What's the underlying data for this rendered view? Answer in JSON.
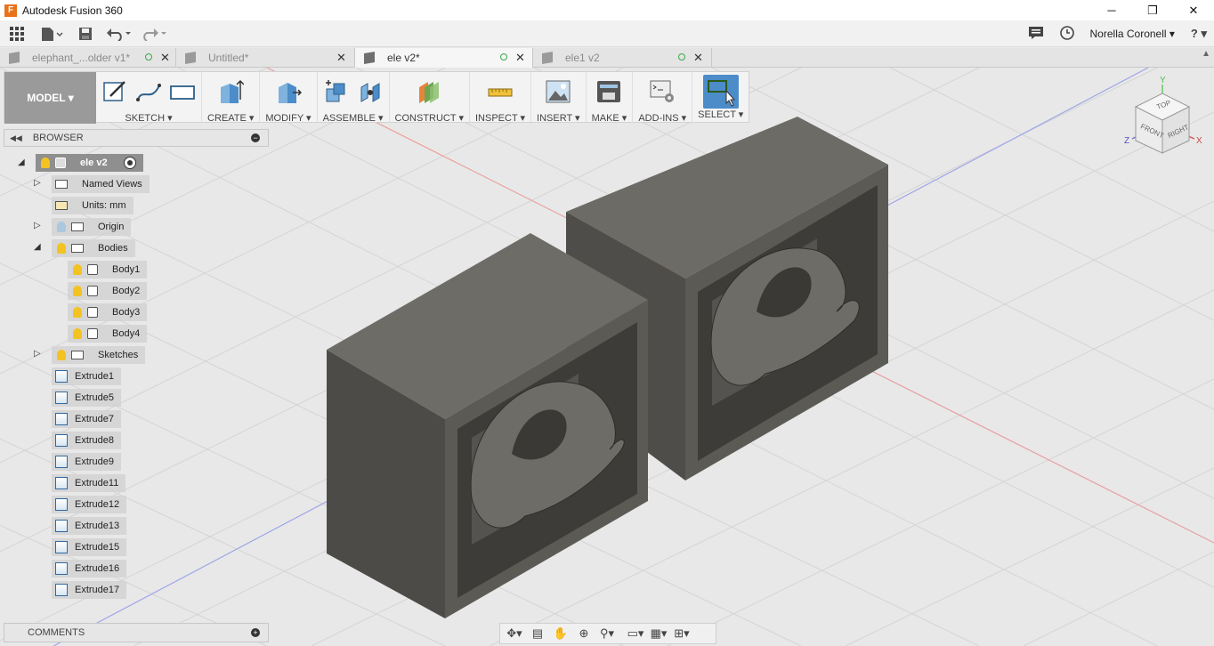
{
  "window": {
    "title": "Autodesk Fusion 360",
    "app_icon": "F",
    "minimize": "─",
    "maximize": "❐",
    "close": "✕"
  },
  "qat": {
    "user_name": "Norella Coronell ▾",
    "help": "? ▾"
  },
  "tabs": [
    {
      "label": "elephant_...older v1*",
      "active": false
    },
    {
      "label": "Untitled*",
      "active": false
    },
    {
      "label": "ele v2*",
      "active": true
    },
    {
      "label": "ele1 v2",
      "active": false
    }
  ],
  "toolbar": {
    "workspace": "MODEL ▾",
    "groups": [
      {
        "label": "SKETCH ▾",
        "icons": [
          "sketch-create-icon",
          "spline-icon",
          "rectangle-icon"
        ]
      },
      {
        "label": "CREATE ▾",
        "icons": [
          "extrude-box-icon"
        ]
      },
      {
        "label": "MODIFY ▾",
        "icons": [
          "press-pull-icon"
        ]
      },
      {
        "label": "ASSEMBLE ▾",
        "icons": [
          "new-component-icon",
          "joint-icon"
        ]
      },
      {
        "label": "CONSTRUCT ▾",
        "icons": [
          "offset-plane-icon"
        ]
      },
      {
        "label": "INSPECT ▾",
        "icons": [
          "measure-icon"
        ]
      },
      {
        "label": "INSERT ▾",
        "icons": [
          "insert-image-icon"
        ]
      },
      {
        "label": "MAKE ▾",
        "icons": [
          "3d-print-icon"
        ]
      },
      {
        "label": "ADD-INS ▾",
        "icons": [
          "scripts-icon"
        ]
      },
      {
        "label": "SELECT ▾",
        "icons": [
          "select-icon"
        ]
      }
    ]
  },
  "browser": {
    "title": "BROWSER",
    "root": "ele v2",
    "named_views": "Named Views",
    "units": "Units: mm",
    "origin": "Origin",
    "bodies": "Bodies",
    "body_items": [
      "Body1",
      "Body2",
      "Body3",
      "Body4"
    ],
    "sketches": "Sketches",
    "features": [
      "Extrude1",
      "Extrude5",
      "Extrude7",
      "Extrude8",
      "Extrude9",
      "Extrude11",
      "Extrude12",
      "Extrude13",
      "Extrude15",
      "Extrude16",
      "Extrude17"
    ]
  },
  "comments": {
    "title": "COMMENTS"
  },
  "viewcube": {
    "top": "TOP",
    "front": "FRONT",
    "right": "RIGHT",
    "x": "X",
    "y": "Y",
    "z": "Z"
  },
  "colors": {
    "model_face_top": "#6c6a65",
    "model_face_front": "#55534f",
    "model_face_side": "#4a4844",
    "grid": "#d7d7d7",
    "axis_x": "#e07b7b",
    "axis_y": "#7b7be0",
    "select_blue": "#4b8cc9"
  }
}
